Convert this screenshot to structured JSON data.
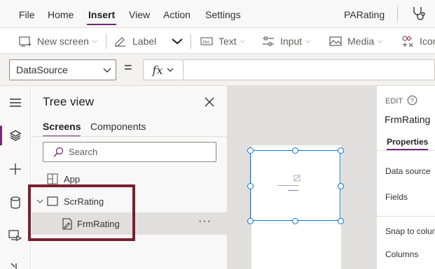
{
  "menu": {
    "items": [
      "File",
      "Home",
      "Insert",
      "View",
      "Action",
      "Settings"
    ],
    "active": "Insert",
    "app_name": "PARating"
  },
  "toolbar": {
    "new_screen": "New screen",
    "label": "Label",
    "text": "Text",
    "input": "Input",
    "media": "Media",
    "icons": "Icons"
  },
  "formula": {
    "property": "DataSource",
    "equals": "=",
    "fx": "fx",
    "value": ""
  },
  "tree": {
    "title": "Tree view",
    "tabs": [
      "Screens",
      "Components"
    ],
    "active_tab": "Screens",
    "search_placeholder": "Search",
    "app_label": "App",
    "screen_label": "ScrRating",
    "form_label": "FrmRating",
    "more": "···"
  },
  "properties": {
    "edit_label": "EDIT",
    "control_name": "FrmRating",
    "tab": "Properties",
    "rows": [
      "Data source",
      "Fields",
      "Snap to columns",
      "Columns"
    ]
  },
  "colors": {
    "accent": "#742774",
    "highlight": "#7b1f2e",
    "selection": "#0078d4"
  }
}
